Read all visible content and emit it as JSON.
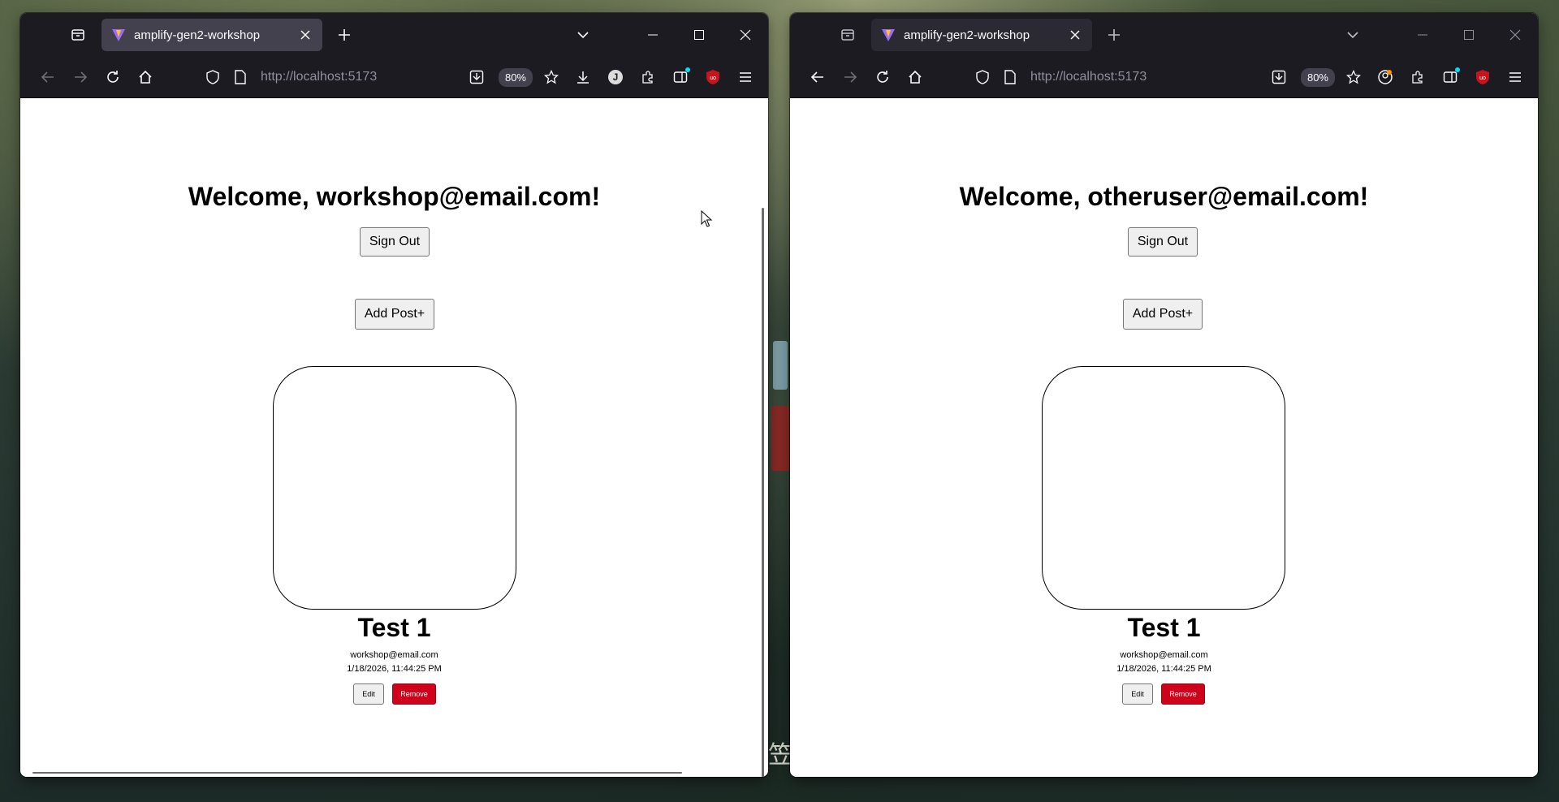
{
  "windows": [
    {
      "id": "left",
      "tab": {
        "title": "amplify-gen2-workshop"
      },
      "url": "http://localhost:5173",
      "zoom": "80%",
      "account_initial": "J",
      "page": {
        "welcome": "Welcome, workshop@email.com!",
        "sign_out_label": "Sign Out",
        "add_post_label": "Add Post+",
        "post": {
          "title": "Test 1",
          "author": "workshop@email.com",
          "date": "1/18/2026, 11:44:25 PM",
          "edit_label": "Edit",
          "remove_label": "Remove"
        }
      }
    },
    {
      "id": "right",
      "tab": {
        "title": "amplify-gen2-workshop"
      },
      "url": "http://localhost:5173",
      "zoom": "80%",
      "page": {
        "welcome": "Welcome, otheruser@email.com!",
        "sign_out_label": "Sign Out",
        "add_post_label": "Add Post+",
        "post": {
          "title": "Test 1",
          "author": "workshop@email.com",
          "date": "1/18/2026, 11:44:25 PM",
          "edit_label": "Edit",
          "remove_label": "Remove"
        }
      }
    }
  ],
  "colors": {
    "chrome": "#1c1b22",
    "tab_active": "#42414d",
    "remove_button": "#d0021b",
    "ublock_red": "#c4161c"
  }
}
